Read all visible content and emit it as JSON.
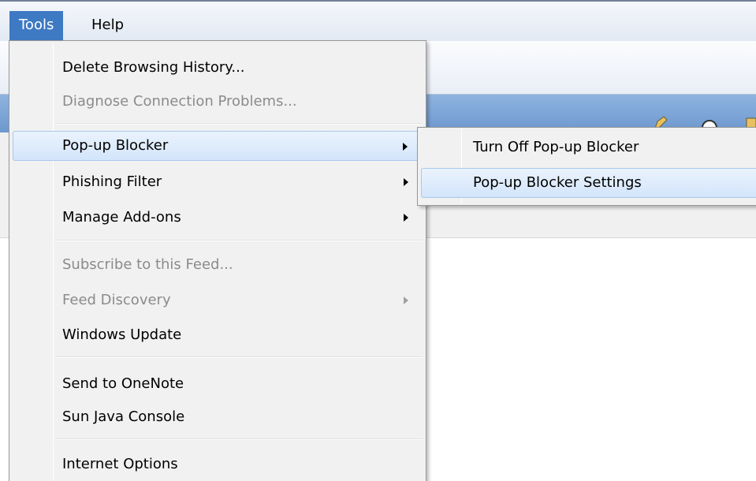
{
  "menubar": {
    "items": [
      {
        "label": "Tools"
      },
      {
        "label": "Help"
      }
    ]
  },
  "toolbar": {
    "icons": [
      "home-icon",
      "feeds-icon",
      "print-icon",
      "page-icon"
    ]
  },
  "tools_menu": {
    "items": [
      {
        "label": "Delete Browsing History...",
        "enabled": true
      },
      {
        "label": "Diagnose Connection Problems...",
        "enabled": false
      },
      {
        "label": "Pop-up Blocker",
        "enabled": true,
        "submenu": true,
        "highlighted": true
      },
      {
        "label": "Phishing Filter",
        "enabled": true,
        "submenu": true
      },
      {
        "label": "Manage Add-ons",
        "enabled": true,
        "submenu": true
      },
      {
        "label": "Subscribe to this Feed...",
        "enabled": false
      },
      {
        "label": "Feed Discovery",
        "enabled": false,
        "submenu": true
      },
      {
        "label": "Windows Update",
        "enabled": true
      },
      {
        "label": "Send to OneNote",
        "enabled": true
      },
      {
        "label": "Sun Java Console",
        "enabled": true
      },
      {
        "label": "Internet Options",
        "enabled": true
      }
    ]
  },
  "popup_submenu": {
    "items": [
      {
        "label": "Turn Off Pop-up Blocker"
      },
      {
        "label": "Pop-up Blocker Settings",
        "highlighted": true
      }
    ]
  },
  "colors": {
    "menu_highlight": "#3e79c4",
    "menu_background": "#f1f1f1",
    "disabled_text": "#8b8b8b",
    "hover_border": "#a8c8ec"
  }
}
